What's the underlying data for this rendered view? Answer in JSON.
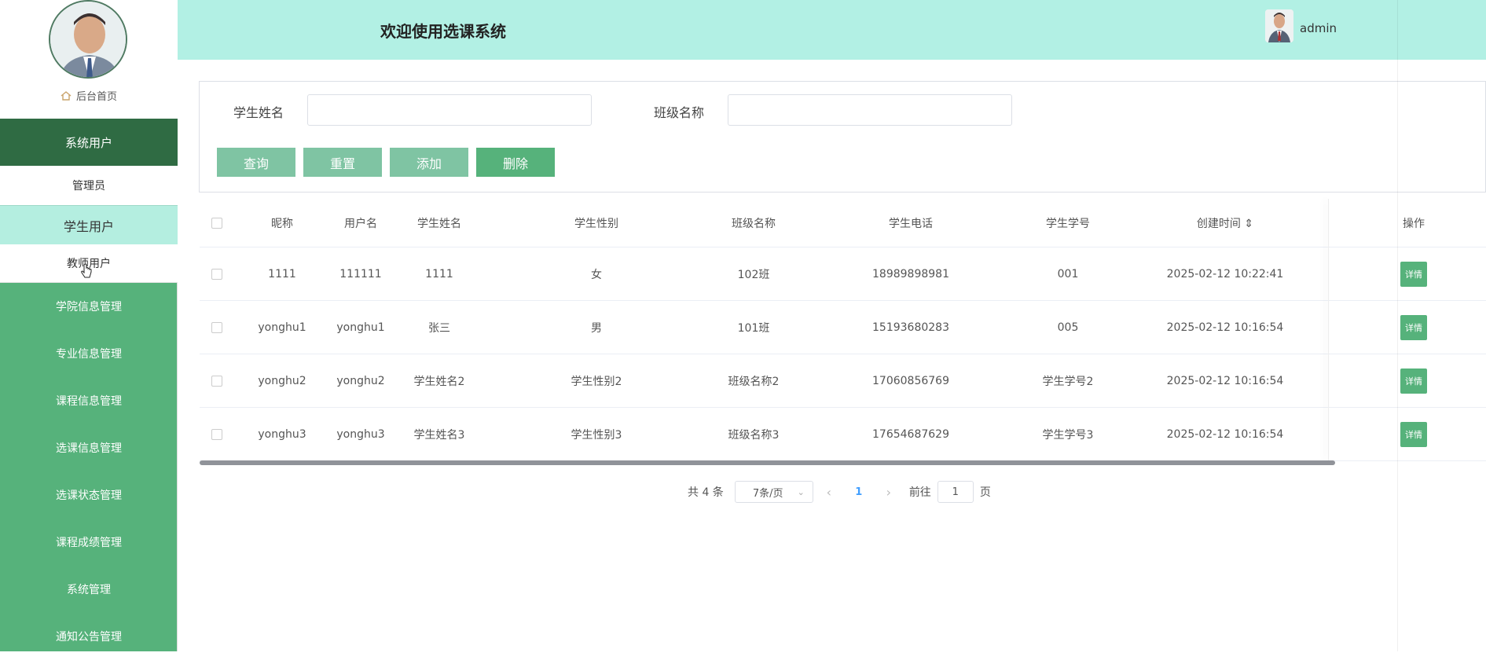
{
  "header": {
    "title": "欢迎使用选课系统",
    "username": "admin"
  },
  "sidebar": {
    "home_label": "后台首页",
    "system_user_label": "系统用户",
    "sub_admin": "管理员",
    "sub_student": "学生用户",
    "sub_teacher": "教师用户",
    "items": [
      {
        "label": "学院信息管理"
      },
      {
        "label": "专业信息管理"
      },
      {
        "label": "课程信息管理"
      },
      {
        "label": "选课信息管理"
      },
      {
        "label": "选课状态管理"
      },
      {
        "label": "课程成绩管理"
      },
      {
        "label": "系统管理"
      },
      {
        "label": "通知公告管理"
      }
    ]
  },
  "search": {
    "student_name_label": "学生姓名",
    "class_name_label": "班级名称",
    "student_name_value": "",
    "class_name_value": "",
    "buttons": {
      "query": "查询",
      "reset": "重置",
      "add": "添加",
      "delete": "删除"
    }
  },
  "table": {
    "headers": {
      "nickname": "昵称",
      "username": "用户名",
      "student_name": "学生姓名",
      "gender": "学生性别",
      "class_name": "班级名称",
      "phone": "学生电话",
      "student_no": "学生学号",
      "created": "创建时间 ⇕",
      "action": "操作"
    },
    "rows": [
      {
        "nickname": "1111",
        "username": "111111",
        "student_name": "1111",
        "gender": "女",
        "class_name": "102班",
        "phone": "18989898981",
        "student_no": "001",
        "created": "2025-02-12 10:22:41",
        "action": "详情"
      },
      {
        "nickname": "yonghu1",
        "username": "yonghu1",
        "student_name": "张三",
        "gender": "男",
        "class_name": "101班",
        "phone": "15193680283",
        "student_no": "005",
        "created": "2025-02-12 10:16:54",
        "action": "详情"
      },
      {
        "nickname": "yonghu2",
        "username": "yonghu2",
        "student_name": "学生姓名2",
        "gender": "学生性别2",
        "class_name": "班级名称2",
        "phone": "17060856769",
        "student_no": "学生学号2",
        "created": "2025-02-12 10:16:54",
        "action": "详情"
      },
      {
        "nickname": "yonghu3",
        "username": "yonghu3",
        "student_name": "学生姓名3",
        "gender": "学生性别3",
        "class_name": "班级名称3",
        "phone": "17654687629",
        "student_no": "学生学号3",
        "created": "2025-02-12 10:16:54",
        "action": "详情"
      }
    ]
  },
  "pager": {
    "total": "共 4 条",
    "page_size": "7条/页",
    "current": "1",
    "goto_label": "前往",
    "goto_value": "1",
    "page_unit": "页"
  },
  "colors": {
    "sidebar_green": "#56b27b",
    "sidebar_dark": "#2f6b43",
    "header_bg": "#b2f0e4",
    "btn_light": "#7fc4a3"
  }
}
